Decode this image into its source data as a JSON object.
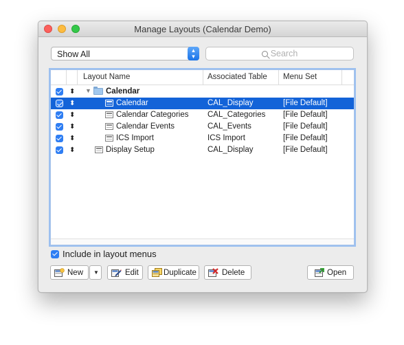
{
  "window": {
    "title": "Manage Layouts (Calendar Demo)"
  },
  "filter": {
    "selected": "Show All"
  },
  "search": {
    "placeholder": "Search"
  },
  "table": {
    "columns": [
      "",
      "",
      "Layout Name",
      "Associated Table",
      "Menu Set"
    ],
    "rows": [
      {
        "name": "Calendar",
        "table": "",
        "menu": "",
        "type": "folder",
        "expanded": true,
        "checked": true,
        "selected": false,
        "indent": 0
      },
      {
        "name": "Calendar",
        "table": "CAL_Display",
        "menu": "[File Default]",
        "type": "layout",
        "checked": true,
        "selected": true,
        "indent": 1
      },
      {
        "name": "Calendar Categories",
        "table": "CAL_Categories",
        "menu": "[File Default]",
        "type": "layout",
        "checked": true,
        "selected": false,
        "indent": 1
      },
      {
        "name": "Calendar Events",
        "table": "CAL_Events",
        "menu": "[File Default]",
        "type": "layout",
        "checked": true,
        "selected": false,
        "indent": 1
      },
      {
        "name": "ICS Import",
        "table": "ICS Import",
        "menu": "[File Default]",
        "type": "layout",
        "checked": true,
        "selected": false,
        "indent": 1
      },
      {
        "name": "Display Setup",
        "table": "CAL_Display",
        "menu": "[File Default]",
        "type": "layout",
        "checked": true,
        "selected": false,
        "indent": 0
      }
    ]
  },
  "include_menus": {
    "label": "Include in layout menus",
    "checked": true
  },
  "buttons": {
    "new": "New",
    "edit": "Edit",
    "duplicate": "Duplicate",
    "delete": "Delete",
    "open": "Open"
  },
  "colors": {
    "selection": "#1363d8",
    "checkbox": "#2f7ef3",
    "table_focus": "#9cc0f0"
  },
  "icons": {
    "new": "new-layout-icon",
    "edit": "pencil-icon",
    "duplicate": "duplicate-icon",
    "delete": "delete-x-icon",
    "open": "open-layout-icon",
    "folder": "folder-icon",
    "layout": "layout-icon"
  }
}
